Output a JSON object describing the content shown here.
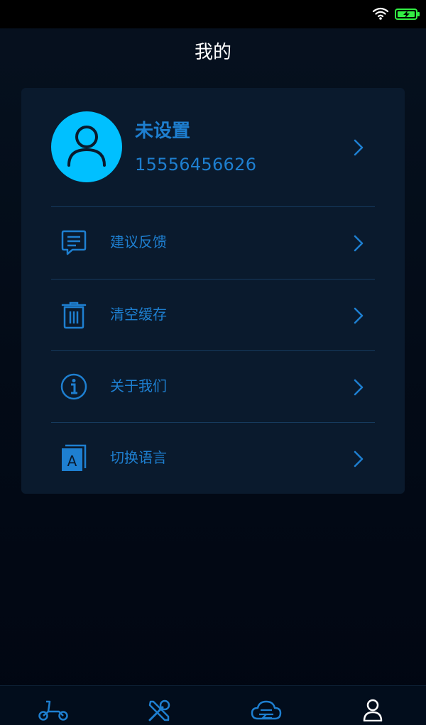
{
  "page": {
    "title": "我的"
  },
  "profile": {
    "name": "未设置",
    "phone": "15556456626"
  },
  "menu": {
    "items": [
      {
        "label": "建议反馈",
        "icon": "feedback-icon"
      },
      {
        "label": "清空缓存",
        "icon": "trash-icon"
      },
      {
        "label": "关于我们",
        "icon": "info-icon"
      },
      {
        "label": "切换语言",
        "icon": "language-icon"
      }
    ]
  },
  "bottom_nav": {
    "tabs": [
      {
        "icon": "scooter-icon",
        "active": false
      },
      {
        "icon": "tools-icon",
        "active": false
      },
      {
        "icon": "cloud-icon",
        "active": false
      },
      {
        "icon": "user-icon",
        "active": true
      }
    ]
  },
  "colors": {
    "accent": "#1e7fd0",
    "avatar_bg": "#00c0ff",
    "card_bg": "#0a1a2d",
    "battery": "#33ee44"
  }
}
